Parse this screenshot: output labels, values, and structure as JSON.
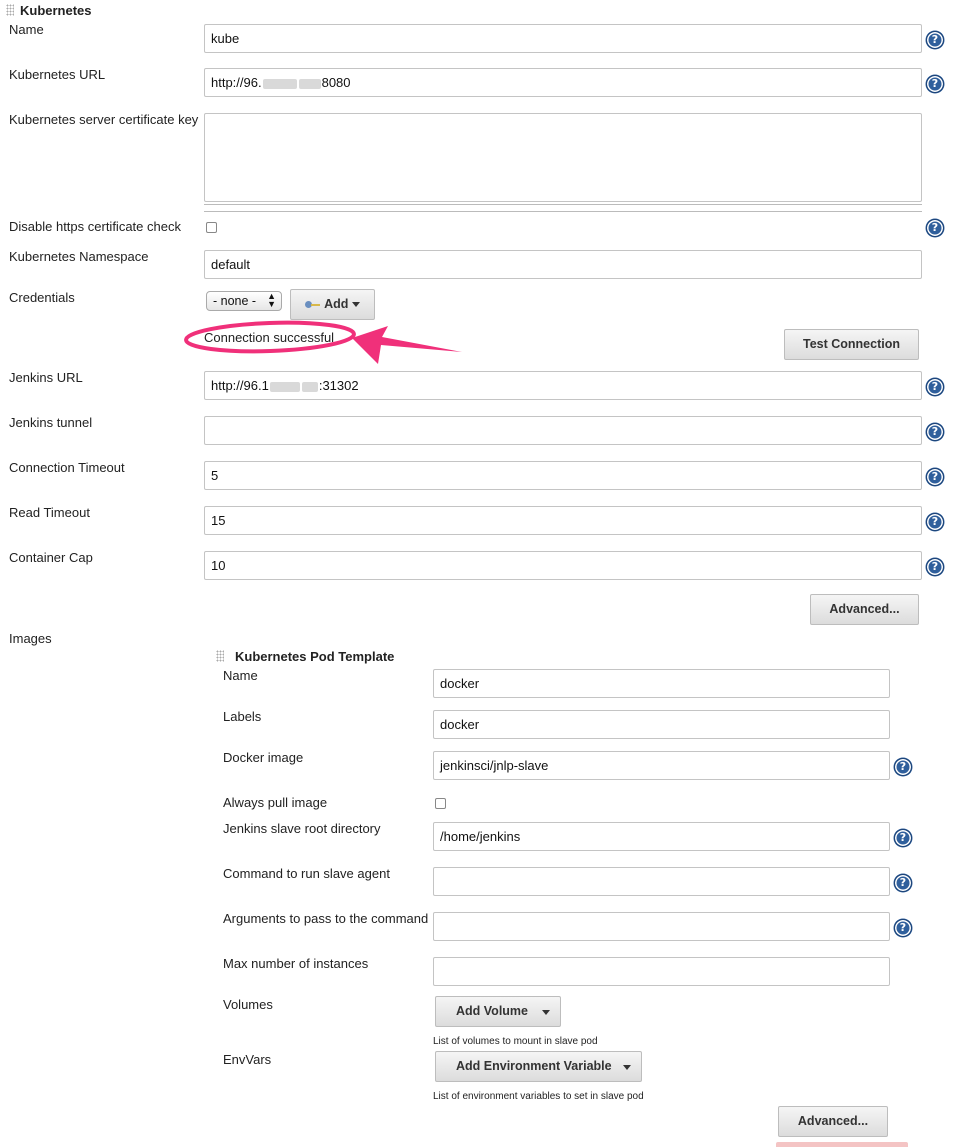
{
  "kubernetes": {
    "section_title": "Kubernetes",
    "fields": {
      "name": {
        "label": "Name",
        "value": "kube"
      },
      "url": {
        "label": "Kubernetes URL",
        "value_prefix": "http://96.",
        "value_suffix": "8080"
      },
      "cert_key": {
        "label": "Kubernetes server certificate key",
        "value": ""
      },
      "disable_https": {
        "label": "Disable https certificate check",
        "checked": false
      },
      "namespace": {
        "label": "Kubernetes Namespace",
        "value": "default"
      },
      "credentials": {
        "label": "Credentials",
        "selected": "- none -",
        "add_label": "Add"
      },
      "connection_status": "Connection successful",
      "test_connection_label": "Test Connection",
      "jenkins_url": {
        "label": "Jenkins URL",
        "value_prefix": "http://96.1",
        "value_suffix": ":31302"
      },
      "jenkins_tunnel": {
        "label": "Jenkins tunnel",
        "value": ""
      },
      "connection_timeout": {
        "label": "Connection Timeout",
        "value": "5"
      },
      "read_timeout": {
        "label": "Read Timeout",
        "value": "15"
      },
      "container_cap": {
        "label": "Container Cap",
        "value": "10"
      }
    },
    "advanced_label": "Advanced...",
    "images_label": "Images"
  },
  "pod_template": {
    "section_title": "Kubernetes Pod Template",
    "name": {
      "label": "Name",
      "value": "docker"
    },
    "labels": {
      "label": "Labels",
      "value": "docker"
    },
    "docker_image": {
      "label": "Docker image",
      "value": "jenkinsci/jnlp-slave"
    },
    "always_pull": {
      "label": "Always pull image",
      "checked": false
    },
    "root_dir": {
      "label": "Jenkins slave root directory",
      "value": "/home/jenkins"
    },
    "command": {
      "label": "Command to run slave agent",
      "value": ""
    },
    "arguments": {
      "label": "Arguments to pass to the command",
      "value": ""
    },
    "max_instances": {
      "label": "Max number of instances",
      "value": ""
    },
    "volumes": {
      "label": "Volumes",
      "button": "Add Volume",
      "hint": "List of volumes to mount in slave pod"
    },
    "envvars": {
      "label": "EnvVars",
      "button": "Add Environment Variable",
      "hint": "List of environment variables to set in slave pod"
    },
    "advanced_label": "Advanced..."
  },
  "annotation": {
    "color": "#f0307a"
  }
}
